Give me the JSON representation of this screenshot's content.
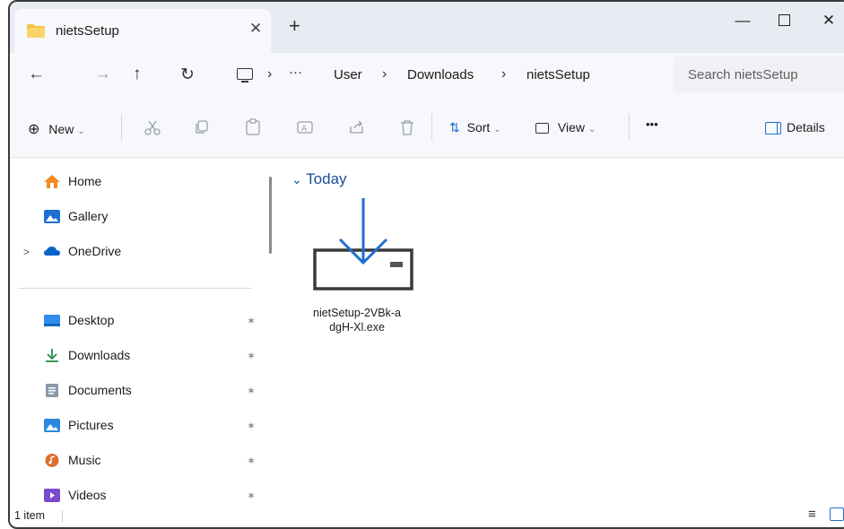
{
  "window": {
    "tab_title": "nietsSetup",
    "close_tab_glyph": "✕",
    "new_tab_glyph": "+",
    "minimize_glyph": "—",
    "close_glyph": "✕"
  },
  "nav": {
    "back_glyph": "←",
    "forward_glyph": "→",
    "up_glyph": "↑",
    "refresh_glyph": "↻",
    "breadcrumb": {
      "sep": "›",
      "more": "···",
      "items": [
        "User",
        "Downloads",
        "nietsSetup"
      ]
    },
    "search_placeholder": "Search nietsSetup"
  },
  "toolbar": {
    "new_label": "New",
    "sort_label": "Sort",
    "view_label": "View",
    "more_label": "•••",
    "details_label": "Details",
    "chevron": "⌄",
    "plus_glyph": "⊕",
    "sort_glyph": "⇅"
  },
  "sidebar": {
    "expand_glyph": ">",
    "pin_glyph": "📌",
    "top_items": [
      {
        "label": "Home",
        "icon": "home-icon"
      },
      {
        "label": "Gallery",
        "icon": "gallery-icon"
      },
      {
        "label": "OneDrive",
        "icon": "onedrive-icon"
      }
    ],
    "pinned_items": [
      {
        "label": "Desktop",
        "icon": "desktop-icon"
      },
      {
        "label": "Downloads",
        "icon": "download-icon"
      },
      {
        "label": "Documents",
        "icon": "documents-icon"
      },
      {
        "label": "Pictures",
        "icon": "pictures-icon"
      },
      {
        "label": "Music",
        "icon": "music-icon"
      },
      {
        "label": "Videos",
        "icon": "videos-icon"
      }
    ]
  },
  "content": {
    "group_label": "Today",
    "group_chevron": "⌄",
    "file_name_line1": "nietSetup-2VBk-a",
    "file_name_line2": "dgH-Xl.exe"
  },
  "status": {
    "item_count": "1 item",
    "list_view_glyph": "≡"
  },
  "colors": {
    "accent": "#1f6fd1",
    "folder": "#f5c044",
    "group_header": "#1a4e9b"
  }
}
